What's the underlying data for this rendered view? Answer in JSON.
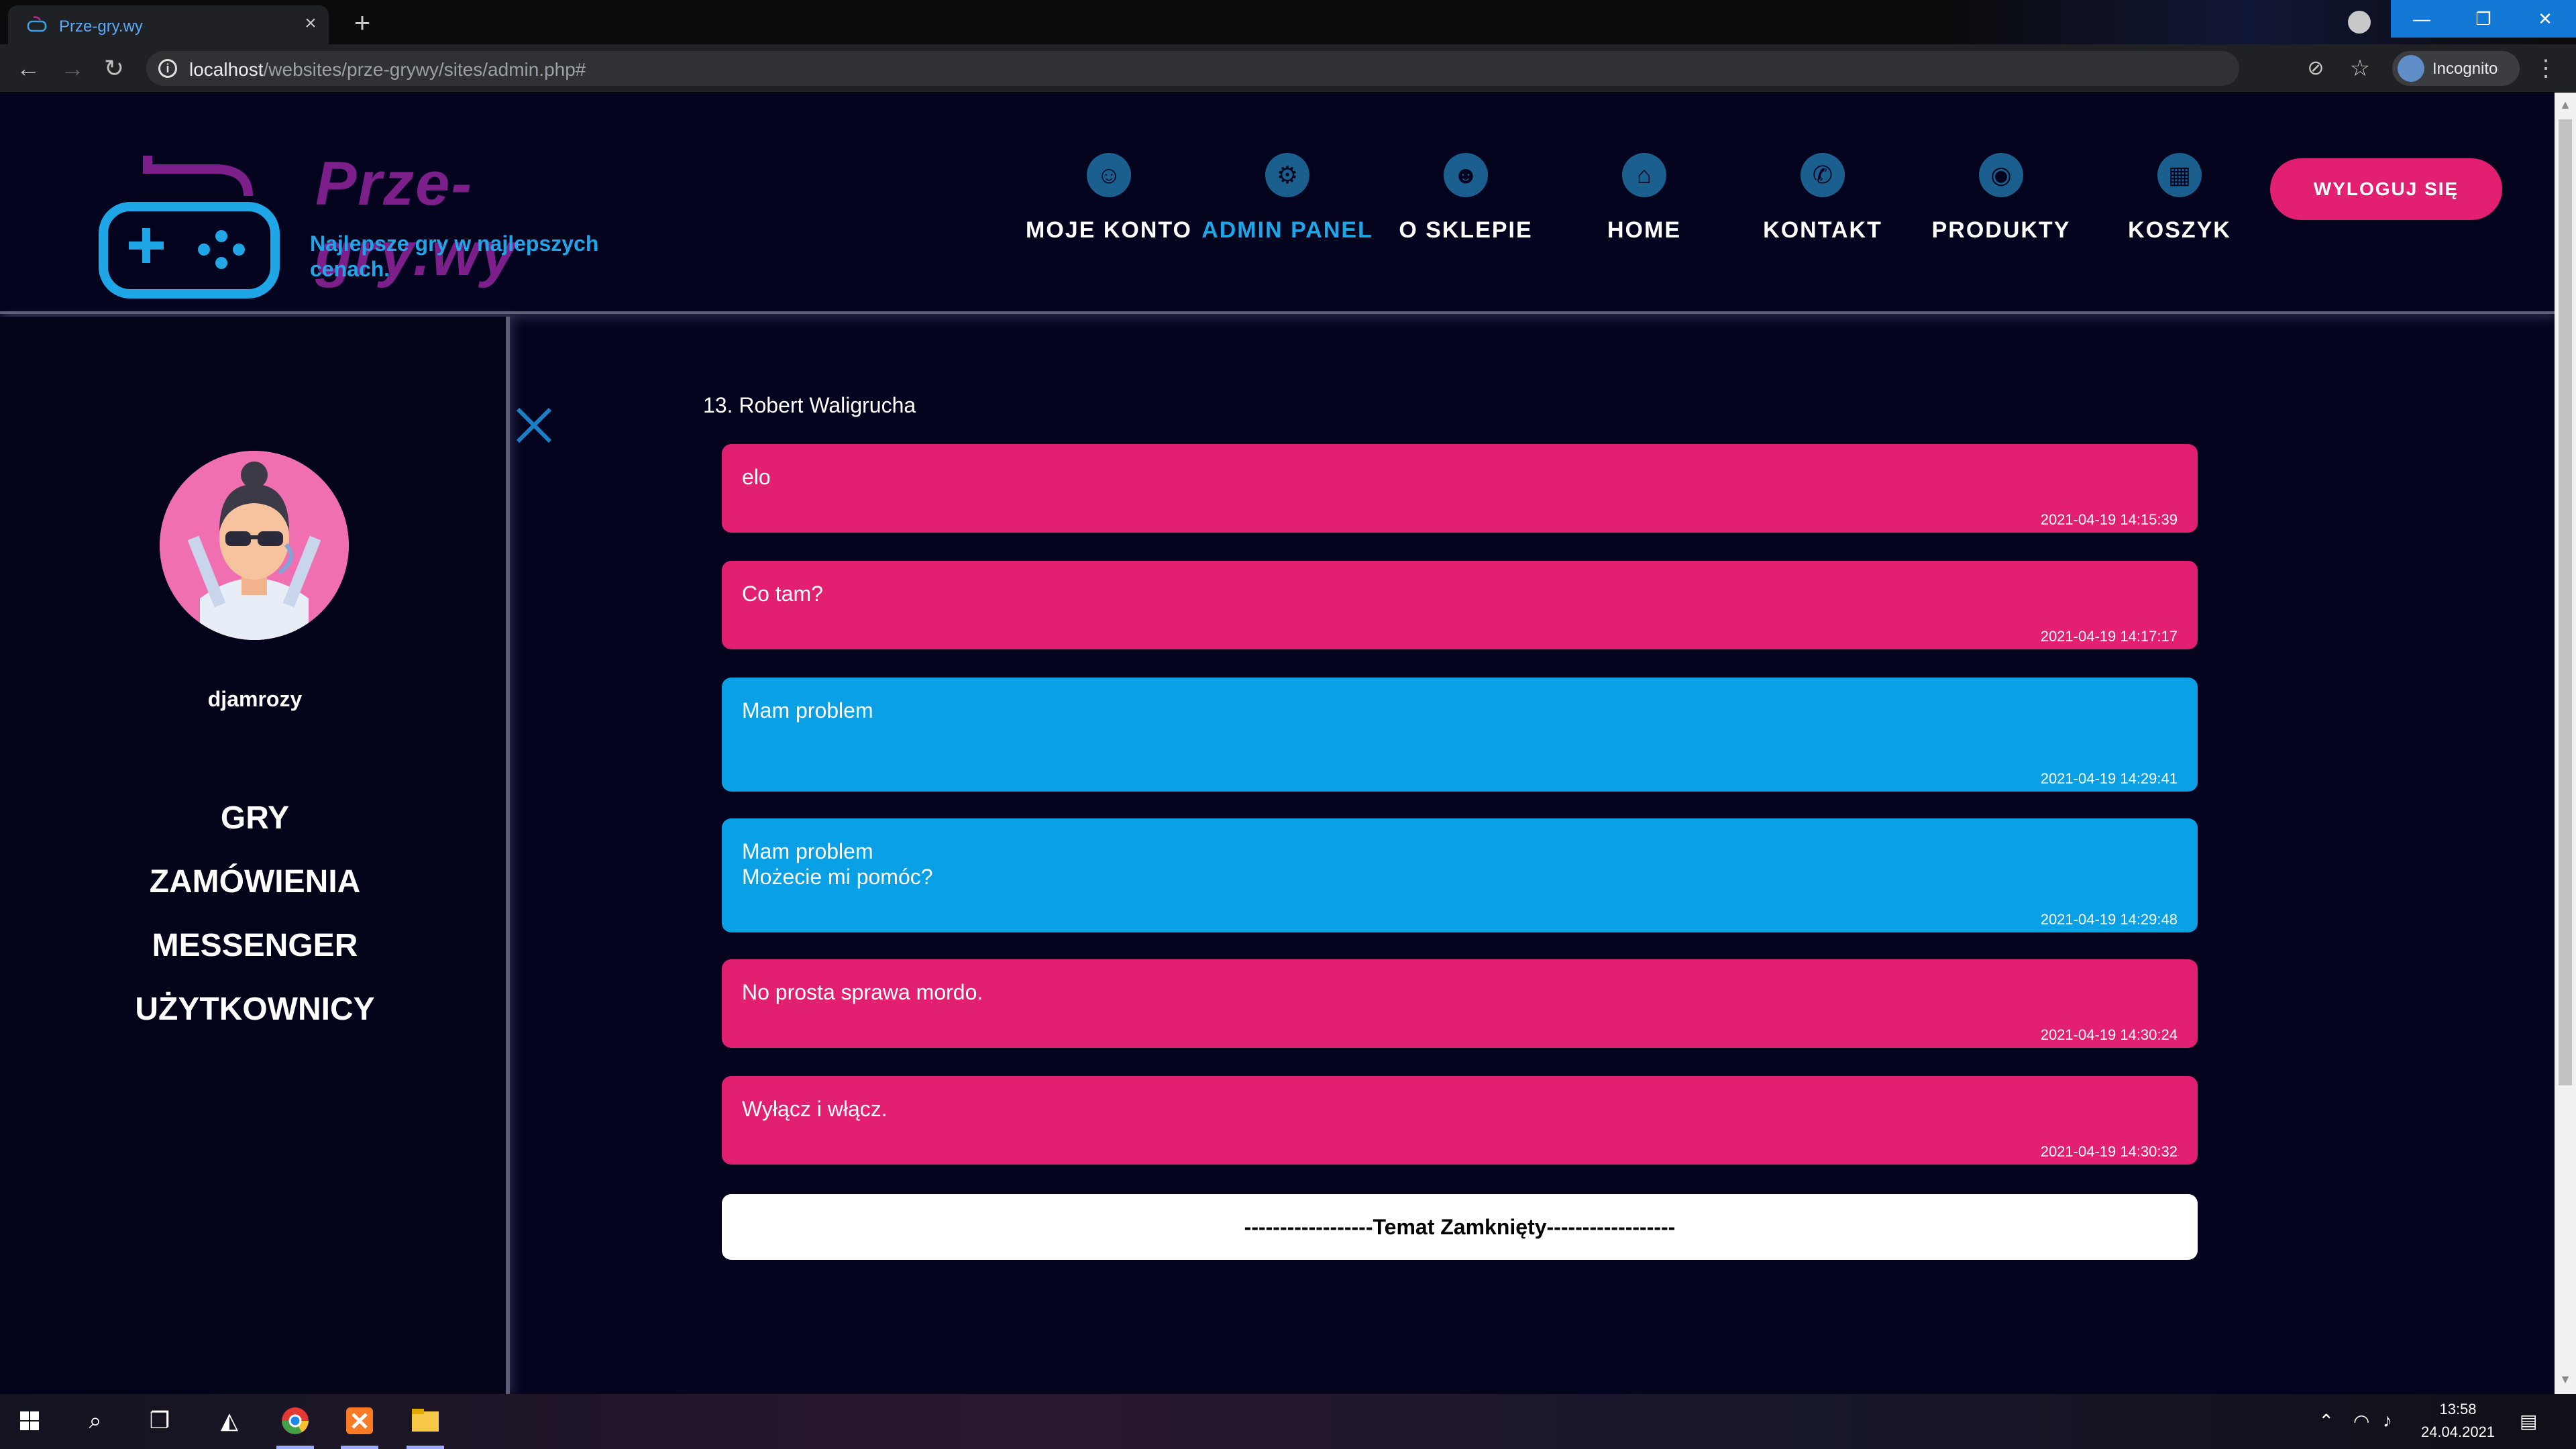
{
  "browser": {
    "tab_title": "Prze-gry.wy",
    "url_host": "localhost",
    "url_path": "/websites/prze-grywy/sites/admin.php#",
    "incognito_label": "Incognito"
  },
  "site": {
    "logo_text": "Prze-gry.wy",
    "tagline": "Najlepsze gry w najlepszych cenach.",
    "nav": [
      {
        "label": "MOJE KONTO",
        "icon": "user-glasses-icon",
        "active": false
      },
      {
        "label": "ADMIN PANEL",
        "icon": "admin-wrench-icon",
        "active": true
      },
      {
        "label": "O SKLEPIE",
        "icon": "people-icon",
        "active": false
      },
      {
        "label": "HOME",
        "icon": "home-icon",
        "active": false
      },
      {
        "label": "KONTAKT",
        "icon": "phone-icon",
        "active": false
      },
      {
        "label": "PRODUKTY",
        "icon": "gamepad-icon",
        "active": false
      },
      {
        "label": "KOSZYK",
        "icon": "cart-icon",
        "active": false
      }
    ],
    "logout_label": "WYLOGUJ SIĘ"
  },
  "sidebar": {
    "username": "djamrozy",
    "menu": [
      "GRY",
      "ZAMÓWIENIA",
      "MESSENGER",
      "UŻYTKOWNICY"
    ]
  },
  "chat": {
    "title": "13. Robert Waligrucha",
    "messages": [
      {
        "text": "elo",
        "time": "2021-04-19 14:15:39",
        "color": "pink"
      },
      {
        "text": "Co tam?",
        "time": "2021-04-19 14:17:17",
        "color": "pink"
      },
      {
        "text": "Mam problem",
        "time": "2021-04-19 14:29:41",
        "color": "blue"
      },
      {
        "text": "Mam problem\nMożecie mi pomóc?",
        "time": "2021-04-19 14:29:48",
        "color": "blue"
      },
      {
        "text": "No prosta sprawa mordo.",
        "time": "2021-04-19 14:30:24",
        "color": "pink"
      },
      {
        "text": "Wyłącz i włącz.",
        "time": "2021-04-19 14:30:32",
        "color": "pink"
      }
    ],
    "closed_label": "------------------Temat Zamknięty------------------"
  },
  "taskbar": {
    "time": "13:58",
    "date": "24.04.2021"
  },
  "colors": {
    "accent_pink": "#e31f72",
    "accent_blue": "#0aa0e6",
    "background": "#04041f"
  }
}
